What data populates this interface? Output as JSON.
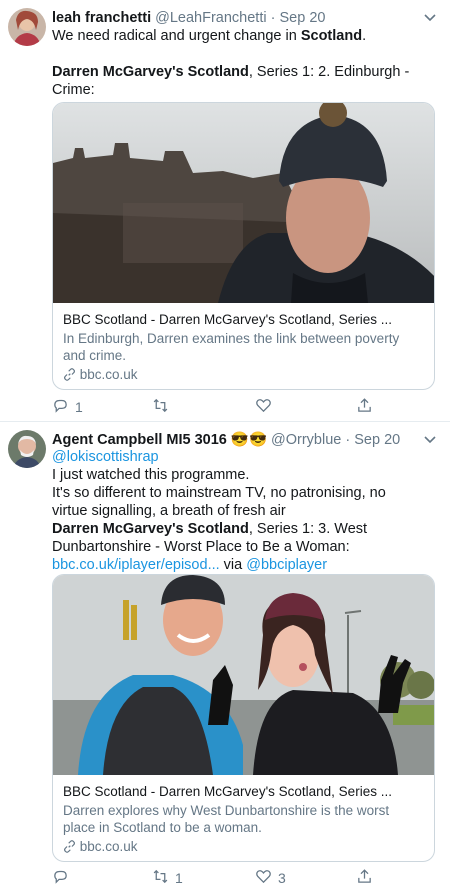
{
  "tweets": [
    {
      "name": "leah franchetti",
      "handle": "@LeahFranchetti",
      "sep": "·",
      "date": "Sep 20",
      "line1_pre": "We need radical and urgent change in ",
      "line1_bold": "Scotland",
      "line1_post": ".",
      "line2_bold": "Darren McGarvey's Scotland",
      "line2_post": ", Series 1: 2. Edinburgh -",
      "line3": "Crime:",
      "card": {
        "title": "BBC Scotland - Darren McGarvey's Scotland, Series ...",
        "desc": "In Edinburgh, Darren examines the link between poverty and crime.",
        "domain": "bbc.co.uk"
      },
      "replies": "1",
      "retweets": "",
      "likes": ""
    },
    {
      "name": "Agent Campbell MI5 3016",
      "emoji": "😎😎",
      "handle": "@Orryblue",
      "sep": "·",
      "date": "Sep 20",
      "mention": "@lokiscottishrap",
      "line1": "I just watched this programme.",
      "line2": "It's so different to mainstream TV, no patronising, no",
      "line3": "virtue signalling, a breath of fresh air",
      "line4_bold": "Darren McGarvey's Scotland",
      "line4_post": ", Series 1: 3. West",
      "line5": "Dunbartonshire - Worst Place to Be a Woman:",
      "url": "bbc.co.uk/iplayer/episod...",
      "via": " via ",
      "via_handle": "@bbciplayer",
      "card": {
        "title": "BBC Scotland - Darren McGarvey's Scotland, Series ...",
        "desc": "Darren explores why West Dunbartonshire is the worst place in Scotland to be a woman.",
        "domain": "bbc.co.uk"
      },
      "replies": "",
      "retweets": "1",
      "likes": "3"
    }
  ],
  "icons": {
    "reply": "reply-icon",
    "retweet": "retweet-icon",
    "like": "heart-icon",
    "share": "share-icon",
    "more": "chevron-down-icon",
    "link": "link-icon"
  },
  "colors": {
    "link": "#1b95e0",
    "secondary": "#657786",
    "border": "#ccd6dd"
  }
}
